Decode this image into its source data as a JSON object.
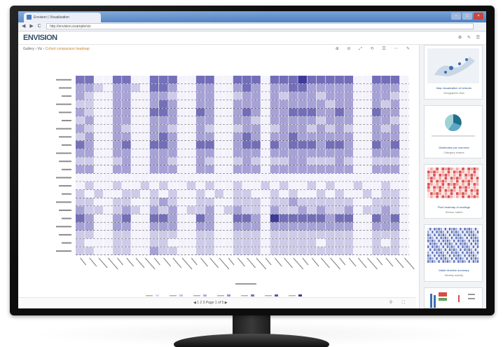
{
  "browser": {
    "tab_title": "Envision | Visualization",
    "url": "http://envision.example/viz",
    "nav_icons": "◀ ▶ C",
    "window_buttons": [
      "–",
      "□",
      "×"
    ]
  },
  "app": {
    "logo": "ENVISION",
    "header_icons": "⚙ ✎ ☰",
    "breadcrumb_prefix": "Gallery › Viz ›",
    "breadcrumb_link": "Cohort comparison heatmap",
    "tool_icons": "⊕ ⊖ ⤢ ⟲ ☰ ⋯ ✎",
    "status_text": "◀  1 2 3  Page 1 of 5  ▶",
    "status_icons": "⚲ ⛶"
  },
  "sidebar": {
    "cards": [
      {
        "caption": "Map visualization of network",
        "sub": "Geographic view"
      },
      {
        "caption": "Distribution pie overview",
        "sub": "Category shares"
      },
      {
        "caption": "Pixel heatmap of readings",
        "sub": "Sensor matrix"
      },
      {
        "caption": "Matrix timeline summary",
        "sub": "Weekly activity"
      },
      {
        "caption": "Bar chart comparison",
        "sub": ""
      }
    ]
  },
  "colors": {
    "heat_low": "#f4f3fb",
    "heat_mid": "#a7a2d6",
    "heat_high": "#3d3a99",
    "accent": "#c77b1a"
  },
  "chart_data": {
    "type": "heatmap",
    "rows": 22,
    "cols": 36,
    "value_range": [
      0,
      4
    ],
    "row_labels": [
      "",
      "",
      "",
      "",
      "",
      "",
      "",
      "",
      "",
      "",
      "",
      "",
      "",
      "",
      "",
      "",
      "",
      "",
      "",
      "",
      "",
      ""
    ],
    "col_labels": [],
    "legend_entries": 7,
    "values": [
      [
        3,
        3,
        0,
        0,
        3,
        3,
        0,
        0,
        3,
        3,
        3,
        0,
        0,
        3,
        3,
        0,
        0,
        3,
        3,
        3,
        0,
        3,
        3,
        3,
        4,
        3,
        3,
        3,
        3,
        3,
        0,
        0,
        3,
        3,
        3,
        0
      ],
      [
        2,
        2,
        1,
        0,
        2,
        2,
        1,
        0,
        3,
        3,
        2,
        0,
        0,
        2,
        2,
        0,
        0,
        2,
        3,
        2,
        0,
        2,
        2,
        3,
        3,
        2,
        2,
        2,
        2,
        2,
        0,
        0,
        2,
        2,
        2,
        0
      ],
      [
        2,
        1,
        0,
        0,
        2,
        2,
        0,
        0,
        2,
        2,
        1,
        0,
        0,
        2,
        2,
        0,
        0,
        1,
        2,
        2,
        0,
        2,
        1,
        2,
        2,
        2,
        1,
        2,
        2,
        2,
        0,
        0,
        2,
        2,
        1,
        0
      ],
      [
        1,
        1,
        0,
        0,
        2,
        2,
        0,
        0,
        2,
        3,
        2,
        0,
        0,
        2,
        2,
        0,
        0,
        2,
        2,
        2,
        0,
        2,
        2,
        2,
        2,
        2,
        2,
        1,
        2,
        2,
        0,
        0,
        2,
        1,
        2,
        0
      ],
      [
        2,
        1,
        0,
        0,
        2,
        2,
        0,
        0,
        3,
        3,
        2,
        0,
        0,
        3,
        2,
        0,
        0,
        2,
        3,
        2,
        0,
        2,
        2,
        3,
        3,
        3,
        2,
        2,
        3,
        2,
        0,
        0,
        3,
        2,
        2,
        0
      ],
      [
        1,
        2,
        0,
        0,
        2,
        2,
        0,
        0,
        2,
        2,
        2,
        0,
        0,
        2,
        2,
        0,
        0,
        2,
        2,
        1,
        0,
        2,
        2,
        2,
        2,
        2,
        1,
        2,
        2,
        2,
        0,
        0,
        2,
        2,
        1,
        0
      ],
      [
        2,
        1,
        0,
        0,
        2,
        1,
        0,
        0,
        2,
        2,
        1,
        0,
        0,
        2,
        1,
        0,
        0,
        1,
        2,
        2,
        0,
        1,
        2,
        2,
        2,
        1,
        2,
        1,
        2,
        1,
        0,
        0,
        2,
        1,
        2,
        0
      ],
      [
        1,
        2,
        0,
        0,
        2,
        2,
        0,
        0,
        2,
        3,
        2,
        0,
        0,
        2,
        2,
        0,
        0,
        2,
        3,
        2,
        0,
        2,
        2,
        3,
        2,
        2,
        2,
        2,
        2,
        2,
        0,
        0,
        2,
        2,
        2,
        0
      ],
      [
        3,
        2,
        0,
        0,
        2,
        3,
        0,
        0,
        3,
        3,
        2,
        0,
        0,
        3,
        3,
        0,
        0,
        2,
        3,
        3,
        0,
        3,
        2,
        3,
        3,
        3,
        2,
        3,
        3,
        2,
        0,
        0,
        3,
        2,
        3,
        0
      ],
      [
        2,
        2,
        0,
        0,
        2,
        2,
        0,
        0,
        2,
        2,
        2,
        0,
        0,
        2,
        2,
        0,
        0,
        2,
        2,
        2,
        0,
        2,
        2,
        2,
        2,
        2,
        2,
        2,
        2,
        2,
        0,
        0,
        2,
        2,
        2,
        0
      ],
      [
        1,
        1,
        0,
        0,
        1,
        2,
        0,
        0,
        2,
        2,
        1,
        0,
        0,
        2,
        1,
        0,
        0,
        1,
        2,
        1,
        0,
        1,
        1,
        2,
        2,
        1,
        1,
        1,
        2,
        1,
        0,
        0,
        1,
        1,
        1,
        0
      ],
      [
        2,
        2,
        0,
        0,
        2,
        2,
        0,
        0,
        2,
        2,
        2,
        0,
        0,
        2,
        2,
        0,
        0,
        2,
        2,
        2,
        0,
        2,
        2,
        2,
        2,
        2,
        2,
        2,
        2,
        2,
        0,
        0,
        2,
        2,
        2,
        0
      ],
      [
        0,
        0,
        0,
        0,
        0,
        0,
        0,
        0,
        0,
        0,
        0,
        0,
        0,
        0,
        0,
        0,
        0,
        0,
        0,
        0,
        0,
        0,
        0,
        0,
        0,
        0,
        0,
        0,
        0,
        0,
        0,
        0,
        0,
        0,
        0,
        0
      ],
      [
        0,
        1,
        0,
        0,
        1,
        0,
        0,
        1,
        0,
        1,
        0,
        0,
        1,
        0,
        1,
        0,
        0,
        1,
        0,
        0,
        1,
        0,
        1,
        0,
        0,
        1,
        0,
        1,
        0,
        0,
        1,
        0,
        0,
        1,
        0,
        0
      ],
      [
        1,
        0,
        1,
        0,
        0,
        1,
        1,
        0,
        1,
        0,
        1,
        0,
        0,
        1,
        0,
        1,
        0,
        1,
        1,
        0,
        0,
        1,
        0,
        1,
        0,
        0,
        1,
        0,
        1,
        0,
        0,
        1,
        0,
        1,
        1,
        0
      ],
      [
        1,
        1,
        0,
        0,
        1,
        1,
        0,
        0,
        1,
        2,
        1,
        0,
        0,
        1,
        1,
        0,
        0,
        1,
        1,
        1,
        0,
        1,
        1,
        2,
        1,
        1,
        1,
        1,
        1,
        1,
        0,
        0,
        1,
        1,
        1,
        0
      ],
      [
        2,
        1,
        1,
        0,
        1,
        2,
        1,
        0,
        2,
        1,
        2,
        0,
        1,
        1,
        2,
        0,
        1,
        2,
        1,
        1,
        0,
        2,
        1,
        1,
        2,
        1,
        2,
        1,
        1,
        2,
        0,
        1,
        1,
        2,
        1,
        0
      ],
      [
        3,
        2,
        0,
        0,
        2,
        3,
        0,
        0,
        3,
        3,
        2,
        0,
        0,
        3,
        2,
        0,
        0,
        3,
        3,
        2,
        0,
        4,
        3,
        3,
        3,
        3,
        3,
        2,
        3,
        3,
        0,
        0,
        3,
        2,
        3,
        0
      ],
      [
        2,
        2,
        0,
        0,
        2,
        2,
        0,
        0,
        2,
        2,
        2,
        0,
        0,
        2,
        2,
        0,
        0,
        2,
        2,
        2,
        0,
        2,
        2,
        2,
        2,
        2,
        2,
        2,
        2,
        2,
        0,
        0,
        2,
        2,
        2,
        0
      ],
      [
        1,
        1,
        0,
        0,
        1,
        1,
        0,
        0,
        1,
        1,
        1,
        0,
        0,
        1,
        1,
        0,
        0,
        1,
        1,
        1,
        0,
        1,
        1,
        1,
        1,
        1,
        1,
        1,
        1,
        1,
        0,
        0,
        1,
        1,
        1,
        0
      ],
      [
        1,
        0,
        0,
        0,
        1,
        1,
        0,
        0,
        1,
        1,
        0,
        0,
        0,
        1,
        1,
        0,
        0,
        1,
        1,
        1,
        0,
        1,
        1,
        1,
        1,
        1,
        0,
        1,
        1,
        1,
        0,
        0,
        1,
        0,
        1,
        0
      ],
      [
        1,
        1,
        0,
        0,
        1,
        1,
        0,
        0,
        2,
        1,
        1,
        0,
        0,
        1,
        1,
        0,
        0,
        1,
        1,
        1,
        0,
        1,
        1,
        1,
        1,
        1,
        1,
        1,
        1,
        1,
        0,
        0,
        1,
        1,
        1,
        0
      ]
    ]
  }
}
